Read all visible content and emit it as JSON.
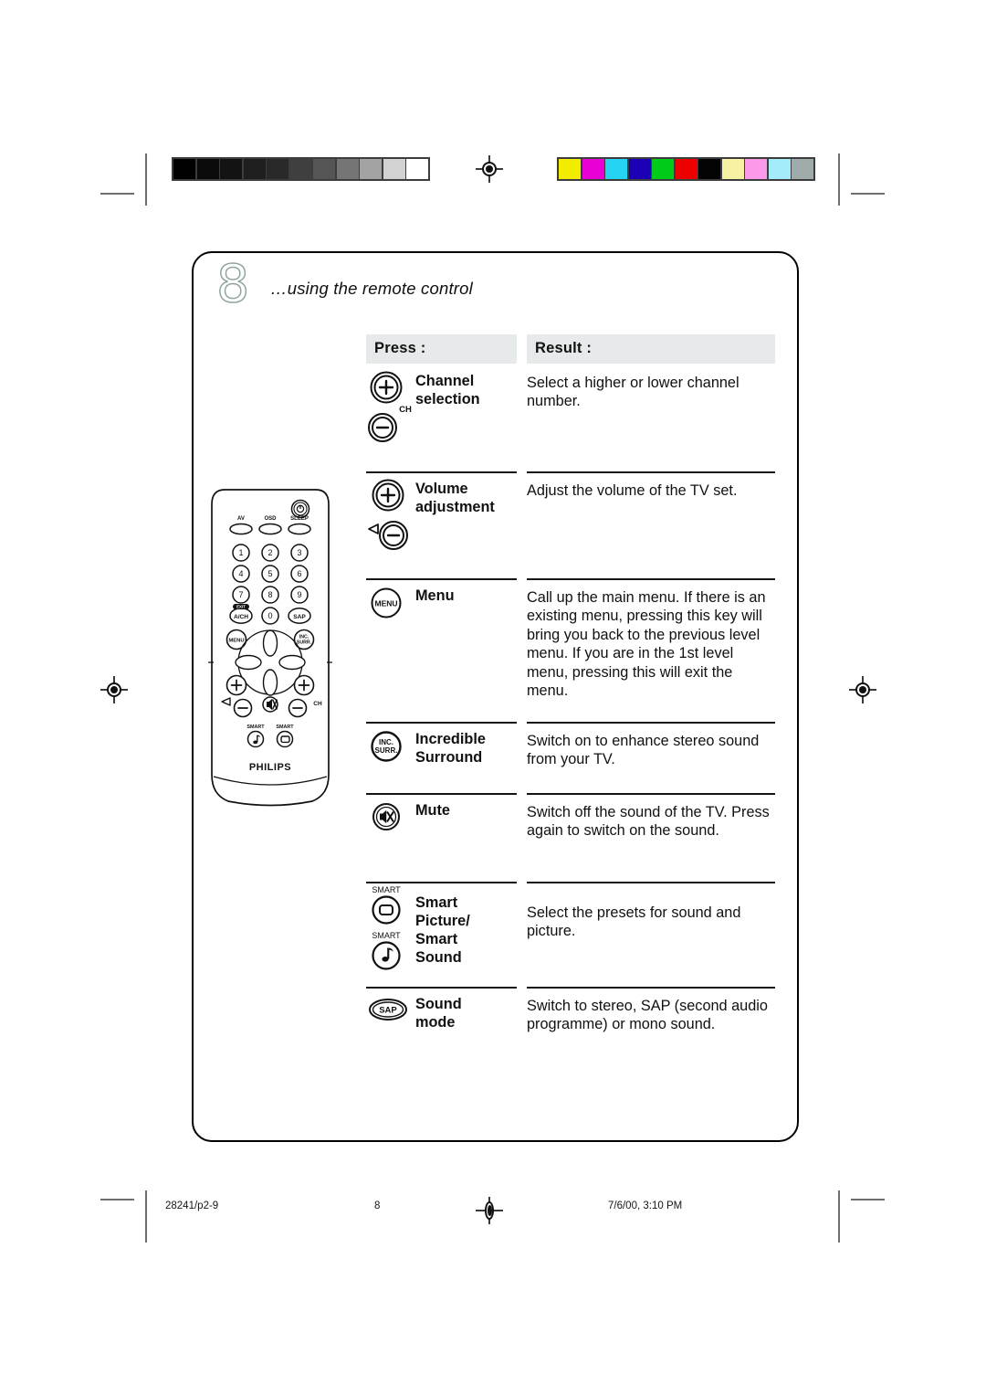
{
  "page": {
    "number_glyph": "8",
    "section_title": "…using the remote control"
  },
  "table": {
    "headers": {
      "press": "Press :",
      "result": "Result :"
    },
    "rows": [
      {
        "icon_names": [
          "channel-plus-button-icon",
          "channel-minus-button-icon"
        ],
        "icon_caption": "CH",
        "label": "Channel\nselection",
        "label_line1": "Channel",
        "label_line2": "selection",
        "result": "Select a higher or lower channel number."
      },
      {
        "icon_names": [
          "volume-plus-button-icon",
          "volume-minus-button-icon"
        ],
        "icon_caption": "",
        "label_line1": "Volume",
        "label_line2": "adjustment",
        "result": "Adjust the volume of the TV set."
      },
      {
        "icon_names": [
          "menu-button-icon"
        ],
        "icon_caption": "MENU",
        "label_line1": "Menu",
        "label_line2": "",
        "result": "Call up the main menu. If there is an existing menu, pressing this key will bring you back to the previous level menu. If you are in the 1st level menu, pressing this will exit the menu."
      },
      {
        "icon_names": [
          "incredible-surround-button-icon"
        ],
        "icon_caption": "INC. SURR.",
        "label_line1": "Incredible",
        "label_line2": "Surround",
        "result": "Switch on to enhance stereo sound from your TV."
      },
      {
        "icon_names": [
          "mute-button-icon"
        ],
        "icon_caption": "",
        "label_line1": "Mute",
        "label_line2": "",
        "result": "Switch off the sound of the TV. Press again to switch on the sound."
      },
      {
        "icon_names": [
          "smart-picture-button-icon",
          "smart-sound-button-icon"
        ],
        "icon_caption": "SMART",
        "label_line1": "Smart",
        "label_line2": "Picture/",
        "label_line3": "Smart",
        "label_line4": "Sound",
        "result": "Select the presets for sound and picture."
      },
      {
        "icon_names": [
          "sap-button-icon"
        ],
        "icon_caption": "SAP",
        "label_line1": "Sound",
        "label_line2": "mode",
        "result": "Switch to stereo, SAP (second audio programme) or mono sound."
      }
    ]
  },
  "remote": {
    "brand": "PHILIPS",
    "top_labels": [
      "AV",
      "OSD",
      "SLEEP"
    ],
    "power_icon": "power-icon",
    "numeric_keys": [
      "1",
      "2",
      "3",
      "4",
      "5",
      "6",
      "7",
      "8",
      "9"
    ],
    "zero_key": "0",
    "ach_key": "A/CH",
    "ach_badge": "EXIT",
    "sap_key": "SAP",
    "menu_key": "MENU",
    "inc_surr_key_line1": "INC.",
    "inc_surr_key_line2": "SURR.",
    "volume_caption": "",
    "channel_caption": "CH",
    "smart_sound_caption": "SMART",
    "smart_picture_caption": "SMART"
  },
  "calibration": {
    "grayscale_swatches": [
      "#010101",
      "#0a0a0a",
      "#131313",
      "#1e1e1e",
      "#292929",
      "#3f3f3f",
      "#555555",
      "#757575",
      "#a3a3a3",
      "#d2d2d2",
      "#ffffff"
    ],
    "color_swatches": [
      "#f2ed00",
      "#e800d5",
      "#25d4f2",
      "#1b00b5",
      "#00cb19",
      "#ef0000",
      "#040404",
      "#f7f2a3",
      "#fa9ae8",
      "#a5ecfa",
      "#a0acab"
    ]
  },
  "footer": {
    "job_code": "28241/p2-9",
    "page_number": "8",
    "timestamp": "7/6/00, 3:10 PM"
  }
}
